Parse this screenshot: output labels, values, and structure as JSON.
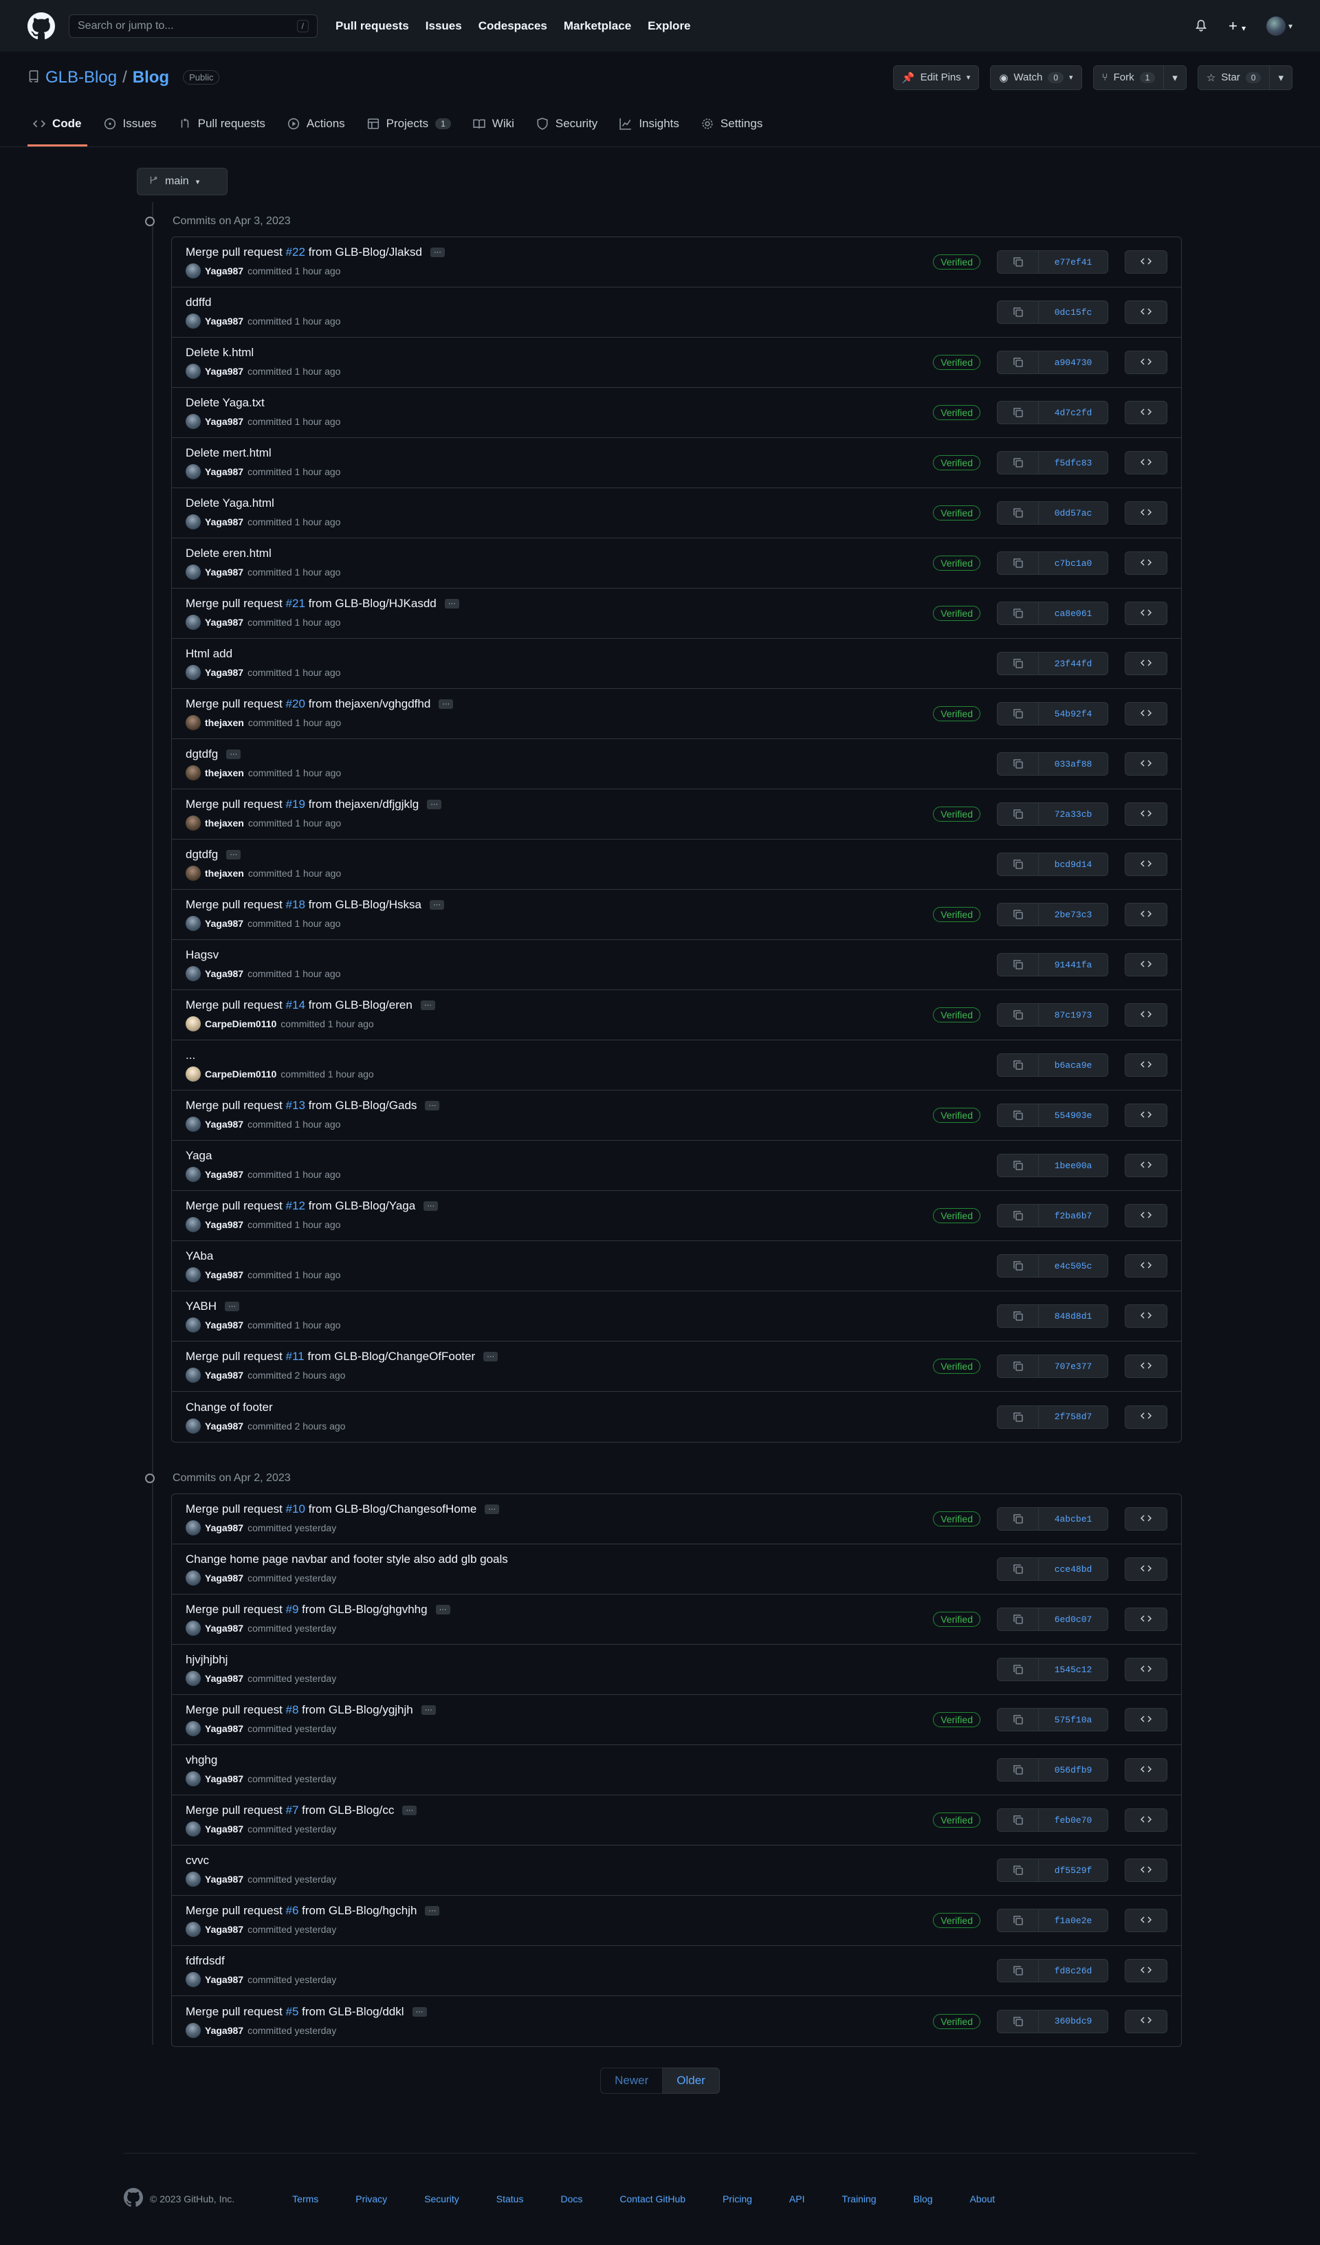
{
  "header": {
    "search_placeholder": "Search or jump to...",
    "search_key": "/",
    "nav": [
      "Pull requests",
      "Issues",
      "Codespaces",
      "Marketplace",
      "Explore"
    ],
    "plus": "+"
  },
  "repo": {
    "owner": "GLB-Blog",
    "sep": "/",
    "name": "Blog",
    "visibility": "Public",
    "edit_pins": "Edit Pins",
    "watch": "Watch",
    "watch_count": "0",
    "fork": "Fork",
    "fork_count": "1",
    "star": "Star",
    "star_count": "0"
  },
  "tabs": [
    {
      "label": "Code",
      "icon": "code-icon"
    },
    {
      "label": "Issues",
      "icon": "issue-icon"
    },
    {
      "label": "Pull requests",
      "icon": "pull-request-icon"
    },
    {
      "label": "Actions",
      "icon": "play-icon"
    },
    {
      "label": "Projects",
      "icon": "table-icon",
      "count": "1"
    },
    {
      "label": "Wiki",
      "icon": "book-icon"
    },
    {
      "label": "Security",
      "icon": "shield-icon"
    },
    {
      "label": "Insights",
      "icon": "graph-icon"
    },
    {
      "label": "Settings",
      "icon": "gear-icon"
    }
  ],
  "branch": "main",
  "groups": [
    {
      "title": "Commits on Apr 3, 2023",
      "commits": [
        {
          "msg": "Merge pull request ",
          "pr": "#22",
          "rest": " from GLB-Blog/Jlaksd",
          "ell": true,
          "user": "Yaga987",
          "time": "committed 1 hour ago",
          "verified": true,
          "sha": "e77ef41",
          "av": "a"
        },
        {
          "msg": "ddffd",
          "user": "Yaga987",
          "time": "committed 1 hour ago",
          "sha": "0dc15fc",
          "av": "a"
        },
        {
          "msg": "Delete k.html",
          "user": "Yaga987",
          "time": "committed 1 hour ago",
          "verified": true,
          "sha": "a904730",
          "av": "a"
        },
        {
          "msg": "Delete Yaga.txt",
          "user": "Yaga987",
          "time": "committed 1 hour ago",
          "verified": true,
          "sha": "4d7c2fd",
          "av": "a"
        },
        {
          "msg": "Delete mert.html",
          "user": "Yaga987",
          "time": "committed 1 hour ago",
          "verified": true,
          "sha": "f5dfc83",
          "av": "a"
        },
        {
          "msg": "Delete Yaga.html",
          "user": "Yaga987",
          "time": "committed 1 hour ago",
          "verified": true,
          "sha": "0dd57ac",
          "av": "a"
        },
        {
          "msg": "Delete eren.html",
          "user": "Yaga987",
          "time": "committed 1 hour ago",
          "verified": true,
          "sha": "c7bc1a0",
          "av": "a"
        },
        {
          "msg": "Merge pull request ",
          "pr": "#21",
          "rest": " from GLB-Blog/HJKasdd",
          "ell": true,
          "user": "Yaga987",
          "time": "committed 1 hour ago",
          "verified": true,
          "sha": "ca8e061",
          "av": "a"
        },
        {
          "msg": "Html add",
          "user": "Yaga987",
          "time": "committed 1 hour ago",
          "sha": "23f44fd",
          "av": "a"
        },
        {
          "msg": "Merge pull request ",
          "pr": "#20",
          "rest": " from thejaxen/vghgdfhd",
          "ell": true,
          "user": "thejaxen",
          "time": "committed 1 hour ago",
          "verified": true,
          "sha": "54b92f4",
          "av": "b"
        },
        {
          "msg": "dgtdfg",
          "ell": true,
          "user": "thejaxen",
          "time": "committed 1 hour ago",
          "sha": "033af88",
          "av": "b"
        },
        {
          "msg": "Merge pull request ",
          "pr": "#19",
          "rest": " from thejaxen/dfjgjklg",
          "ell": true,
          "user": "thejaxen",
          "time": "committed 1 hour ago",
          "verified": true,
          "sha": "72a33cb",
          "av": "b"
        },
        {
          "msg": "dgtdfg",
          "ell": true,
          "user": "thejaxen",
          "time": "committed 1 hour ago",
          "sha": "bcd9d14",
          "av": "b"
        },
        {
          "msg": "Merge pull request ",
          "pr": "#18",
          "rest": " from GLB-Blog/Hsksa",
          "ell": true,
          "user": "Yaga987",
          "time": "committed 1 hour ago",
          "verified": true,
          "sha": "2be73c3",
          "av": "a"
        },
        {
          "msg": "Hagsv",
          "user": "Yaga987",
          "time": "committed 1 hour ago",
          "sha": "91441fa",
          "av": "a"
        },
        {
          "msg": "Merge pull request ",
          "pr": "#14",
          "rest": " from GLB-Blog/eren",
          "ell": true,
          "user": "CarpeDiem0110",
          "time": "committed 1 hour ago",
          "verified": true,
          "sha": "87c1973",
          "av": "c"
        },
        {
          "msg": "...",
          "user": "CarpeDiem0110",
          "time": "committed 1 hour ago",
          "sha": "b6aca9e",
          "av": "c"
        },
        {
          "msg": "Merge pull request ",
          "pr": "#13",
          "rest": " from GLB-Blog/Gads",
          "ell": true,
          "user": "Yaga987",
          "time": "committed 1 hour ago",
          "verified": true,
          "sha": "554903e",
          "av": "a"
        },
        {
          "msg": "Yaga",
          "user": "Yaga987",
          "time": "committed 1 hour ago",
          "sha": "1bee00a",
          "av": "a"
        },
        {
          "msg": "Merge pull request ",
          "pr": "#12",
          "rest": " from GLB-Blog/Yaga",
          "ell": true,
          "user": "Yaga987",
          "time": "committed 1 hour ago",
          "verified": true,
          "sha": "f2ba6b7",
          "av": "a"
        },
        {
          "msg": "YAba",
          "user": "Yaga987",
          "time": "committed 1 hour ago",
          "sha": "e4c505c",
          "av": "a"
        },
        {
          "msg": "YABH",
          "ell": true,
          "user": "Yaga987",
          "time": "committed 1 hour ago",
          "sha": "848d8d1",
          "av": "a"
        },
        {
          "msg": "Merge pull request ",
          "pr": "#11",
          "rest": " from GLB-Blog/ChangeOfFooter",
          "ell": true,
          "user": "Yaga987",
          "time": "committed 2 hours ago",
          "verified": true,
          "sha": "707e377",
          "av": "a"
        },
        {
          "msg": "Change of footer",
          "user": "Yaga987",
          "time": "committed 2 hours ago",
          "sha": "2f758d7",
          "av": "a"
        }
      ]
    },
    {
      "title": "Commits on Apr 2, 2023",
      "commits": [
        {
          "msg": "Merge pull request ",
          "pr": "#10",
          "rest": " from GLB-Blog/ChangesofHome",
          "ell": true,
          "user": "Yaga987",
          "time": "committed yesterday",
          "verified": true,
          "sha": "4abcbe1",
          "av": "a"
        },
        {
          "msg": "Change home page navbar and footer style also add glb goals",
          "user": "Yaga987",
          "time": "committed yesterday",
          "sha": "cce48bd",
          "av": "a"
        },
        {
          "msg": "Merge pull request ",
          "pr": "#9",
          "rest": " from GLB-Blog/ghgvhhg",
          "ell": true,
          "user": "Yaga987",
          "time": "committed yesterday",
          "verified": true,
          "sha": "6ed0c07",
          "av": "a"
        },
        {
          "msg": "hjvjhjbhj",
          "user": "Yaga987",
          "time": "committed yesterday",
          "sha": "1545c12",
          "av": "a"
        },
        {
          "msg": "Merge pull request ",
          "pr": "#8",
          "rest": " from GLB-Blog/ygjhjh",
          "ell": true,
          "user": "Yaga987",
          "time": "committed yesterday",
          "verified": true,
          "sha": "575f10a",
          "av": "a"
        },
        {
          "msg": "vhghg",
          "user": "Yaga987",
          "time": "committed yesterday",
          "sha": "056dfb9",
          "av": "a"
        },
        {
          "msg": "Merge pull request ",
          "pr": "#7",
          "rest": " from GLB-Blog/cc",
          "ell": true,
          "user": "Yaga987",
          "time": "committed yesterday",
          "verified": true,
          "sha": "feb0e70",
          "av": "a"
        },
        {
          "msg": "cvvc",
          "user": "Yaga987",
          "time": "committed yesterday",
          "sha": "df5529f",
          "av": "a"
        },
        {
          "msg": "Merge pull request ",
          "pr": "#6",
          "rest": " from GLB-Blog/hgchjh",
          "ell": true,
          "user": "Yaga987",
          "time": "committed yesterday",
          "verified": true,
          "sha": "f1a0e2e",
          "av": "a"
        },
        {
          "msg": "fdfrdsdf",
          "user": "Yaga987",
          "time": "committed yesterday",
          "sha": "fd8c26d",
          "av": "a"
        },
        {
          "msg": "Merge pull request ",
          "pr": "#5",
          "rest": " from GLB-Blog/ddkl",
          "ell": true,
          "user": "Yaga987",
          "time": "committed yesterday",
          "verified": true,
          "sha": "360bdc9",
          "av": "a"
        }
      ]
    }
  ],
  "verified_label": "Verified",
  "pager": {
    "newer": "Newer",
    "older": "Older"
  },
  "footer": {
    "copyright": "© 2023 GitHub, Inc.",
    "links": [
      "Terms",
      "Privacy",
      "Security",
      "Status",
      "Docs",
      "Contact GitHub",
      "Pricing",
      "API",
      "Training",
      "Blog",
      "About"
    ]
  }
}
